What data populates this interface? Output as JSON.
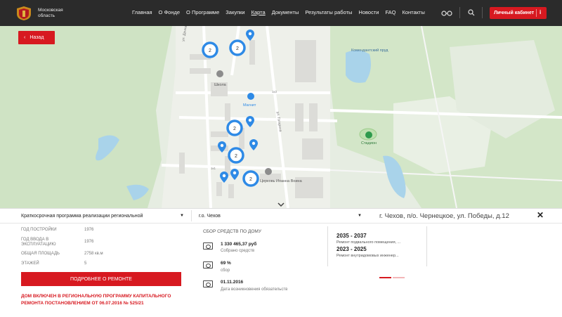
{
  "header": {
    "logo_text": "Московская область",
    "nav": [
      "Главная",
      "О Фонде",
      "О Программе",
      "Закупки",
      "Карта",
      "Документы",
      "Результаты работы",
      "Новости",
      "FAQ",
      "Контакты"
    ],
    "active_nav": "Карта",
    "cabinet_label": "Личный кабинет",
    "cabinet_badge": "i"
  },
  "map": {
    "back_label": "Назад",
    "labels": {
      "school": "Школа",
      "magnit": "Магнит",
      "pond": "Комендантский пруд",
      "stadium": "Стадион",
      "church": "Церковь Иоанна Воина",
      "street_gagarin": "ул. Гагарина",
      "street_victory": "ул. Победы",
      "street_road": "ул. Дачная",
      "bldg_1": "1к1",
      "bldg_2": "1к3"
    },
    "clusters": [
      "2",
      "2",
      "2",
      "2",
      "2"
    ],
    "accent_color": "#2e8ae6"
  },
  "panel": {
    "program_select": "Краткосрочная программа реализации региональной",
    "city_select": "г.о. Чехов",
    "address": "г. Чехов, п/о. Чернецкое, ул. Победы, д.12",
    "properties": [
      {
        "label": "Год постройки",
        "value": "1976"
      },
      {
        "label": "Год ввода в эксплуатацию",
        "value": "1976"
      },
      {
        "label": "Общая площадь",
        "value": "2758 кв.м"
      },
      {
        "label": "Этажей",
        "value": "5"
      }
    ],
    "detail_button": "Подробнее о ремонте",
    "notice": "Дом включен в региональную программу капитального ремонта постановлением от 06.07.2016 № 525/21",
    "collection": {
      "title": "Сбор средств по дому",
      "items": [
        {
          "value": "1 330 465,37 руб",
          "label": "Собрано средств"
        },
        {
          "value": "69 %",
          "label": "сбор"
        },
        {
          "value": "01.11.2016",
          "label": "Дата возникновения обязательств"
        }
      ]
    },
    "schedule": [
      {
        "period": "2035 - 2037",
        "desc": "Ремонт подвального помещения, ..."
      },
      {
        "period": "2023 - 2025",
        "desc": "Ремонт внутридомовых инженер..."
      }
    ],
    "brand_color": "#d71920"
  }
}
